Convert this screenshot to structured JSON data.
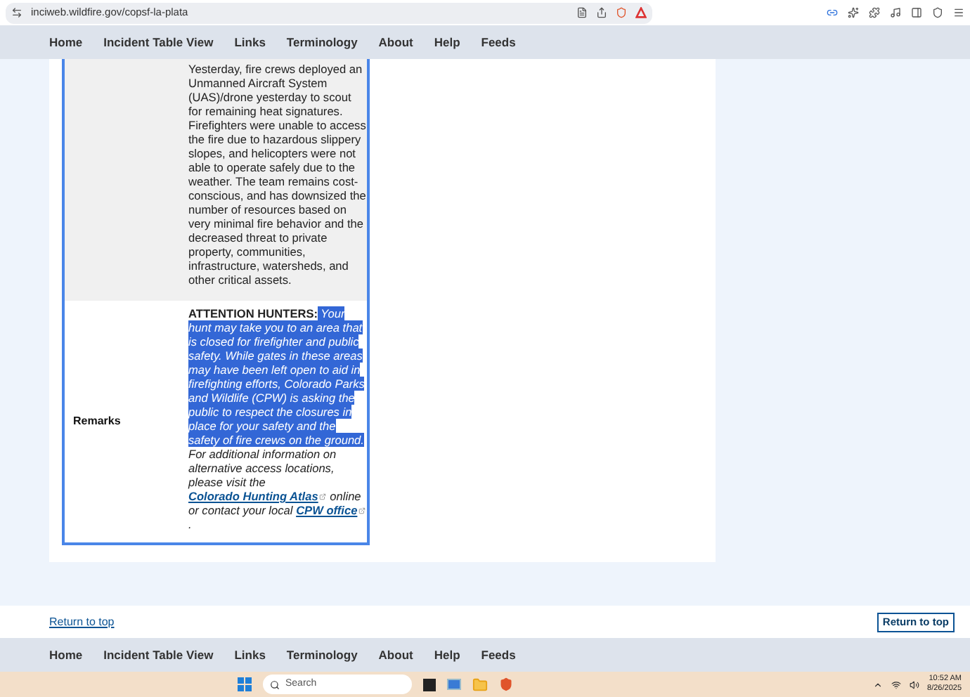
{
  "browser": {
    "url": "inciweb.wildfire.gov/copsf-la-plata"
  },
  "nav": [
    "Home",
    "Incident Table View",
    "Links",
    "Terminology",
    "About",
    "Help",
    "Feeds"
  ],
  "table": {
    "rows": [
      {
        "kind": "text",
        "label": "",
        "text": "Yesterday, fire crews deployed an Unmanned Aircraft System (UAS)/drone yesterday to scout for remaining heat signatures. Firefighters were unable to access the fire due to hazardous slippery slopes, and helicopters were not able to operate safely due to the weather. The team remains cost-conscious, and has downsized the number of resources based on very minimal fire behavior and the decreased threat to private property, communities, infrastructure, watersheds, and other critical assets."
      },
      {
        "kind": "rich",
        "label": "Remarks",
        "segments": [
          {
            "kind": "bold",
            "text": "ATTENTION HUNTERS:"
          },
          {
            "kind": "highlight",
            "text": " Your hunt may take you to an area that is closed for firefighter and public safety. While gates in these areas may have been left open to aid in firefighting efforts, Colorado Parks and Wildlife (CPW) is asking the public to respect the closures in place for your safety and the safety of fire crews on the ground."
          },
          {
            "kind": "plain",
            "text": " For additional information on alternative access locations, please visit the "
          },
          {
            "kind": "link",
            "text": "Colorado Hunting Atlas"
          },
          {
            "kind": "plain",
            "text": "  online or contact your local "
          },
          {
            "kind": "link",
            "text": "CPW office"
          },
          {
            "kind": "plain",
            "text": " ."
          }
        ]
      }
    ]
  },
  "return_link": "Return to top",
  "return_button": "Return to top",
  "footer_nav": [
    "Home",
    "Incident Table View",
    "Links",
    "Terminology",
    "About",
    "Help",
    "Feeds"
  ],
  "taskbar": {
    "search_placeholder": "Search",
    "time": "10:52 AM",
    "date": "8/26/2025"
  }
}
